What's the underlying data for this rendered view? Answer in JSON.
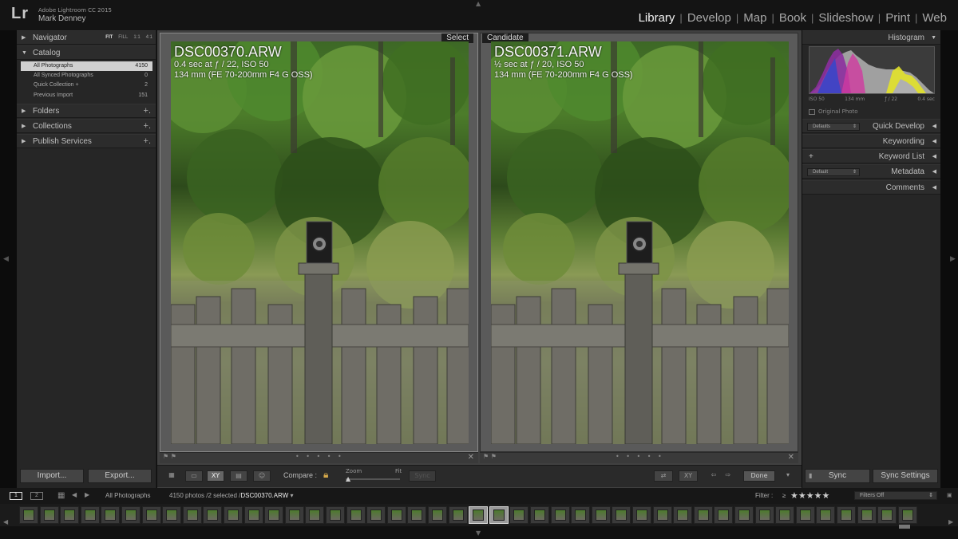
{
  "app": {
    "logo": "Lr",
    "product": "Adobe Lightroom CC 2015",
    "user": "Mark Denney"
  },
  "modules": {
    "items": [
      "Library",
      "Develop",
      "Map",
      "Book",
      "Slideshow",
      "Print",
      "Web"
    ],
    "active": "Library",
    "separator": "|"
  },
  "left_panel": {
    "navigator": {
      "label": "Navigator",
      "sizes": [
        "FIT",
        "FILL",
        "1:1",
        "4:1"
      ]
    },
    "catalog": {
      "label": "Catalog",
      "rows": [
        {
          "label": "All Photographs",
          "count": "4150"
        },
        {
          "label": "All Synced Photographs",
          "count": "0"
        },
        {
          "label": "Quick Collection +",
          "count": "2"
        },
        {
          "label": "Previous Import",
          "count": "151"
        }
      ]
    },
    "folders": "Folders",
    "collections": "Collections",
    "publish": "Publish Services",
    "plus": "+.",
    "import_button": "Import...",
    "export_button": "Export..."
  },
  "compare": {
    "select_tag": "Select",
    "candidate_tag": "Candidate",
    "select": {
      "filename": "DSC00370.ARW",
      "exposure": "0.4 sec at ƒ / 22, ISO 50",
      "lens": "134 mm (FE 70-200mm F4 G OSS)"
    },
    "candidate": {
      "filename": "DSC00371.ARW",
      "exposure": "½ sec at ƒ / 20, ISO 50",
      "lens": "134 mm (FE 70-200mm F4 G OSS)"
    },
    "strip_dots": "• • • • •",
    "close": "✕"
  },
  "toolbar": {
    "compare_label": "Compare :",
    "zoom_label": "Zoom",
    "fit_label": "Fit",
    "sync_label": "Sync",
    "done_label": "Done"
  },
  "right_panel": {
    "histogram": {
      "label": "Histogram",
      "iso": "ISO 50",
      "focal": "134 mm",
      "aperture": "ƒ / 22",
      "shutter": "0.4 sec"
    },
    "original_photo": "Original Photo",
    "defaults_preset": "Defaults",
    "quick_develop": "Quick Develop",
    "keywording": "Keywording",
    "keyword_list": "Keyword List",
    "keyword_plus": "+",
    "default_preset": "Default",
    "metadata": "Metadata",
    "comments": "Comments",
    "sync_button": "Sync",
    "sync_settings_button": "Sync Settings"
  },
  "filmstrip": {
    "page1": "1",
    "page2": "2",
    "source": "All Photographs",
    "count_text": "4150 photos /2 selected /",
    "current_file": "DSC00370.ARW",
    "filter_label": "Filter :",
    "rating_op": "≥",
    "stars": "★★★★★",
    "filters_off": "Filters Off",
    "thumb_count": 44,
    "selected_thumbs": [
      22,
      23
    ]
  },
  "colors": {
    "active_module": "#f2f2f2",
    "lock": "#d4a84a",
    "catalog_selected": "#d0d0d0"
  }
}
